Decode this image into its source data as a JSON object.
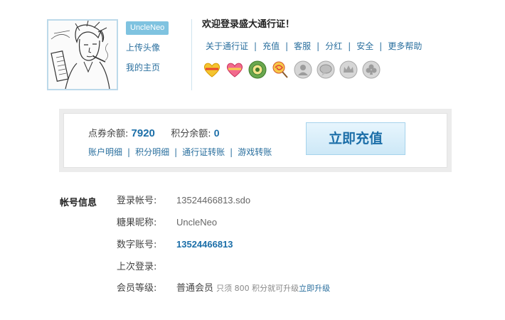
{
  "user": {
    "username": "UncleNeo",
    "upload_avatar": "上传头像",
    "my_home": "我的主页"
  },
  "header": {
    "welcome": "欢迎登录盛大通行证！",
    "nav": [
      {
        "label": "关于通行证"
      },
      {
        "label": "充值"
      },
      {
        "label": "客服"
      },
      {
        "label": "分红"
      },
      {
        "label": "安全"
      },
      {
        "label": "更多帮助"
      }
    ],
    "badges": [
      "heart-gold-badge",
      "heart-pink-badge",
      "green-gear-badge",
      "lollipop-badge",
      "gray-person-badge",
      "gray-speech-badge",
      "gray-crown-badge",
      "gray-club-badge"
    ]
  },
  "balance": {
    "points_label": "点券余额:",
    "points_value": "7920",
    "score_label": "积分余额:",
    "score_value": "0",
    "links": [
      {
        "label": "账户明细"
      },
      {
        "label": "积分明细"
      },
      {
        "label": "通行证转账"
      },
      {
        "label": "游戏转账"
      }
    ],
    "recharge_button": "立即充值"
  },
  "account": {
    "section_title": "帐号信息",
    "rows": [
      {
        "label": "登录帐号:",
        "value": "13524466813.sdo"
      },
      {
        "label": "糖果昵称:",
        "value": "UncleNeo"
      },
      {
        "label": "数字账号:",
        "value": "13524466813"
      },
      {
        "label": "上次登录:",
        "value": ""
      },
      {
        "label": "会员等级:",
        "value": "普通会员"
      }
    ],
    "member_hint": "只须  800 积分就可升级",
    "upgrade_link": "立即升级"
  },
  "colors": {
    "link": "#2a6f9e",
    "accent": "#1b6ea8",
    "badge_bg": "#7fc3e0"
  }
}
